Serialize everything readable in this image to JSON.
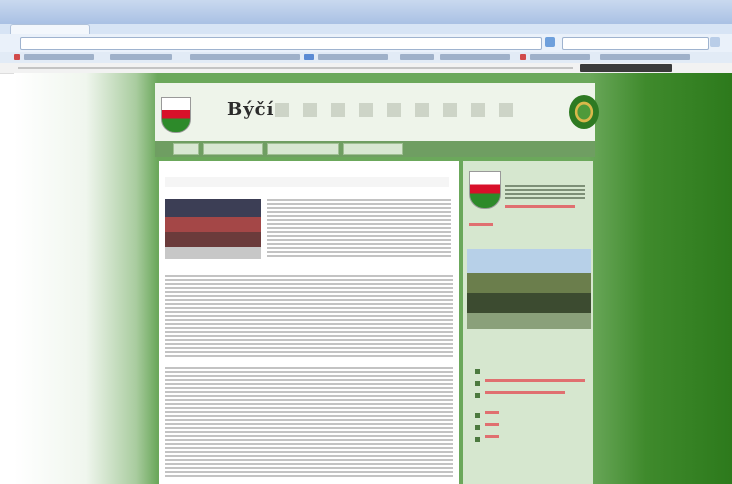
{
  "browser": {
    "window_title": "",
    "tab_label": ""
  },
  "site": {
    "title": "Býčí",
    "nav": [
      "",
      "",
      "",
      "",
      ""
    ]
  },
  "content": {
    "crumb": "",
    "headline": "",
    "subhead": ""
  },
  "sidebar": {
    "title": "",
    "link": "",
    "list": [
      "",
      "",
      "",
      "",
      "",
      ""
    ]
  },
  "colors": {
    "green_bg": "#6ba85b",
    "nav_green": "#6f9e62",
    "accent_red": "#c31e2a",
    "chrome_blue": "#a9c1e4"
  },
  "icons": [
    "window-icon",
    "go-icon",
    "search-icon",
    "crest-icon",
    "emblem-icon"
  ]
}
